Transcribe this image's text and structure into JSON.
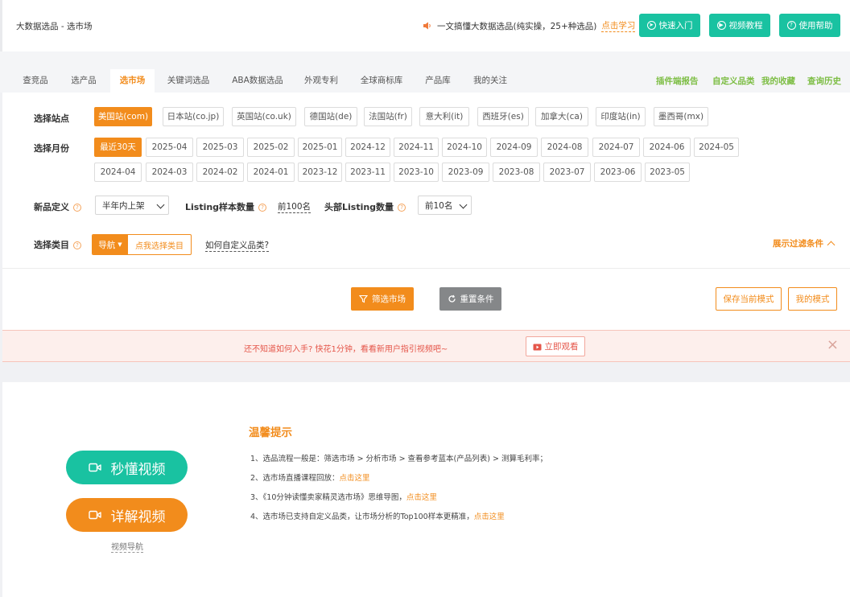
{
  "header": {
    "title": "大数据选品 - 选市场",
    "notice_text": "一文搞懂大数据选品(纯实操，25+种选品)",
    "notice_link": "点击学习",
    "buttons": [
      {
        "label": "快速入门",
        "icon": "arrow-circle-icon"
      },
      {
        "label": "视频教程",
        "icon": "play-circle-icon"
      },
      {
        "label": "使用帮助",
        "icon": "question-circle-icon"
      }
    ]
  },
  "tabs": [
    "查竞品",
    "选产品",
    "选市场",
    "关键词选品",
    "ABA数据选品",
    "外观专利",
    "全球商标库",
    "产品库",
    "我的关注"
  ],
  "active_tab": "选市场",
  "right_links": [
    "插件端报告",
    "自定义品类",
    "我的收藏",
    "查询历史"
  ],
  "filters": {
    "site_label": "选择站点",
    "sites": [
      "美国站(com)",
      "日本站(co.jp)",
      "英国站(co.uk)",
      "德国站(de)",
      "法国站(fr)",
      "意大利(it)",
      "西班牙(es)",
      "加拿大(ca)",
      "印度站(in)",
      "墨西哥(mx)"
    ],
    "selected_site": "美国站(com)",
    "month_label": "选择月份",
    "months_row1": [
      "最近30天",
      "2025-04",
      "2025-03",
      "2025-02",
      "2025-01",
      "2024-12",
      "2024-11",
      "2024-10",
      "2024-09",
      "2024-08",
      "2024-07",
      "2024-06",
      "2024-05"
    ],
    "months_row2": [
      "2024-04",
      "2024-03",
      "2024-02",
      "2024-01",
      "2023-12",
      "2023-11",
      "2023-10",
      "2023-09",
      "2023-08",
      "2023-07",
      "2023-06",
      "2023-05"
    ],
    "selected_month": "最近30天",
    "new_def_label": "新品定义",
    "new_def_value": "半年内上架",
    "sample_label": "Listing样本数量",
    "sample_value": "前100名",
    "head_label": "头部Listing数量",
    "head_value": "前10名",
    "category_label": "选择类目",
    "category_nav": "导航",
    "category_pick": "点我选择类目",
    "custom_category_link": "如何自定义品类?",
    "toggle_label": "展示过滤条件"
  },
  "actions": {
    "filter": "筛选市场",
    "reset": "重置条件",
    "save_mode": "保存当前模式",
    "my_mode": "我的模式"
  },
  "banner": {
    "text": "还不知道如何入手? 快花1分钟，看看新用户指引视频吧~",
    "button": "立即观看",
    "close": "×"
  },
  "tips": {
    "quick_video": "秒懂视频",
    "detail_video": "详解视频",
    "video_nav": "视频导航",
    "title": "温馨提示",
    "items": [
      {
        "text": "1、选品流程一般是：筛选市场 > 分析市场 > 查看参考蓝本(产品列表) > 测算毛利率；",
        "link": ""
      },
      {
        "text": "2、选市场直播课程回放：",
        "link": "点击这里"
      },
      {
        "text": "3、《10分钟读懂卖家精灵选市场》思维导图，",
        "link": "点击这里"
      },
      {
        "text": "4、选市场已支持自定义品类，让市场分析的Top100样本更精准，",
        "link": "点击这里"
      }
    ]
  },
  "colors": {
    "orange": "#f28c1c",
    "teal": "#19c2a1",
    "green": "#7cbd43",
    "gray": "#858789"
  }
}
